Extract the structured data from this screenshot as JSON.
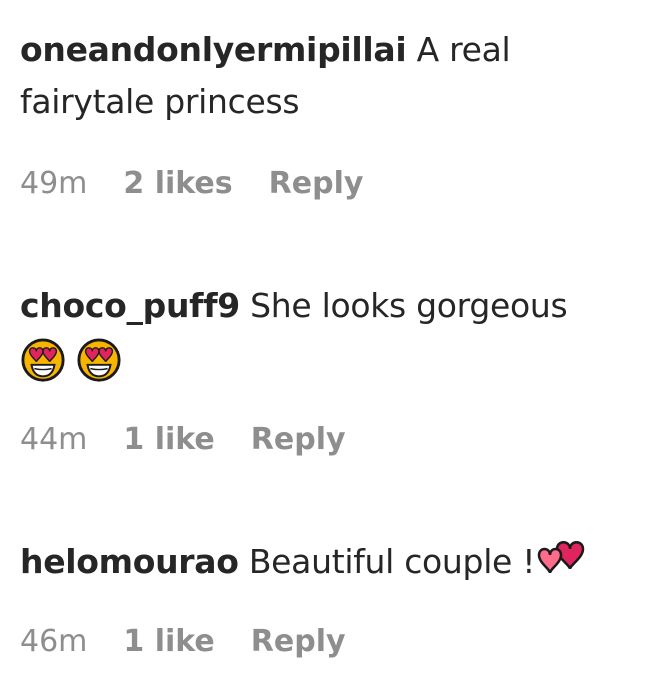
{
  "comments": [
    {
      "username": "oneandonlyermipillai",
      "text": " A real fairytale princess",
      "time": "49m",
      "likes": "2 likes",
      "reply": "Reply"
    },
    {
      "username": "choco_puff9",
      "text": " She looks gorgeous",
      "emojis": [
        "heart-eyes-face",
        "heart-eyes-face"
      ],
      "time": "44m",
      "likes": "1 like",
      "reply": "Reply"
    },
    {
      "username": "helomourao",
      "text": " Beautiful couple !",
      "emojis": [
        "two-hearts"
      ],
      "time": "46m",
      "likes": "1 like",
      "reply": "Reply"
    }
  ],
  "colors": {
    "text": "#262626",
    "meta": "#8e8e8e",
    "emoji_face": "#f7b500",
    "emoji_heart": "#e0245e"
  }
}
